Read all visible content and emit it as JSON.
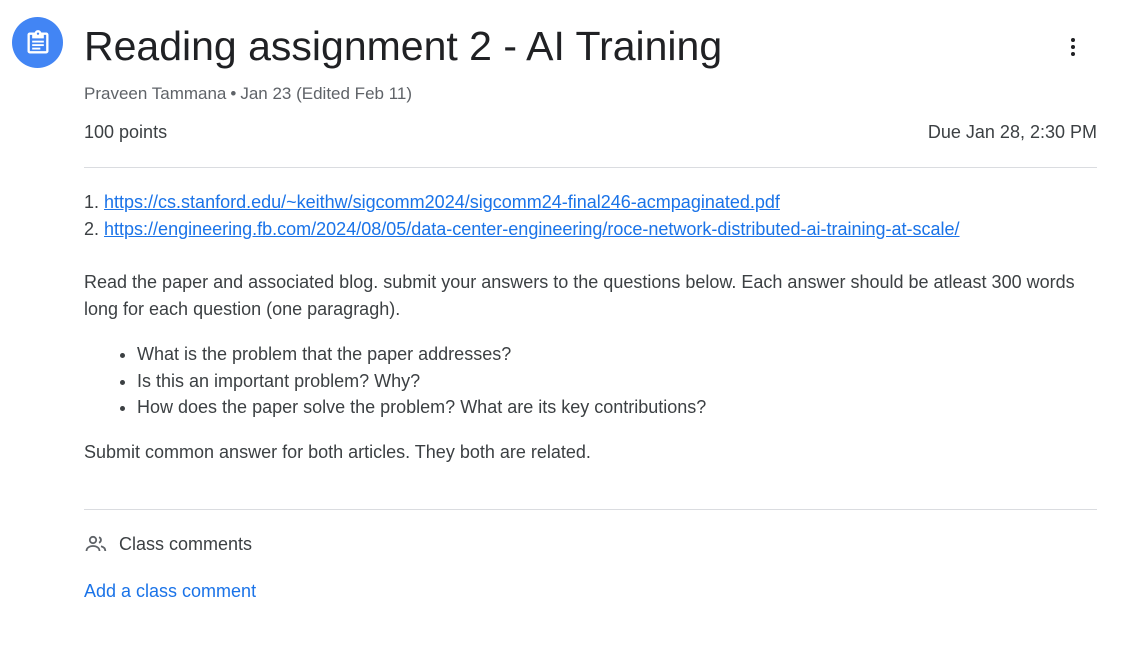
{
  "assignment": {
    "title": "Reading assignment 2 - AI Training",
    "author": "Praveen Tammana",
    "separator": "•",
    "date": "Jan 23 (Edited Feb 11)",
    "points": "100 points",
    "due": "Due Jan 28, 2:30 PM",
    "icon": "assignment-icon",
    "more_icon": "more-vert-icon"
  },
  "content": {
    "links": [
      {
        "num": "1.",
        "text": "https://cs.stanford.edu/~keithw/sigcomm2024/sigcomm24-final246-acmpaginated.pdf"
      },
      {
        "num": "2.",
        "text": "https://engineering.fb.com/2024/08/05/data-center-engineering/roce-network-distributed-ai-training-at-scale/"
      }
    ],
    "instructions": "Read the paper and associated blog. submit your answers to the questions below. Each answer should be atleast 300 words long for each question (one paragragh).",
    "questions": [
      "What is the problem that the paper addresses?",
      "Is this an important problem? Why?",
      "How does the paper solve the problem? What are its key contributions?"
    ],
    "note": "Submit common answer for both articles. They both are related."
  },
  "comments": {
    "heading": "Class comments",
    "add_label": "Add a class comment",
    "icon": "people-icon"
  },
  "colors": {
    "accent": "#4285f4",
    "link": "#1a73e8",
    "text": "#3c4043",
    "muted": "#5f6368"
  }
}
